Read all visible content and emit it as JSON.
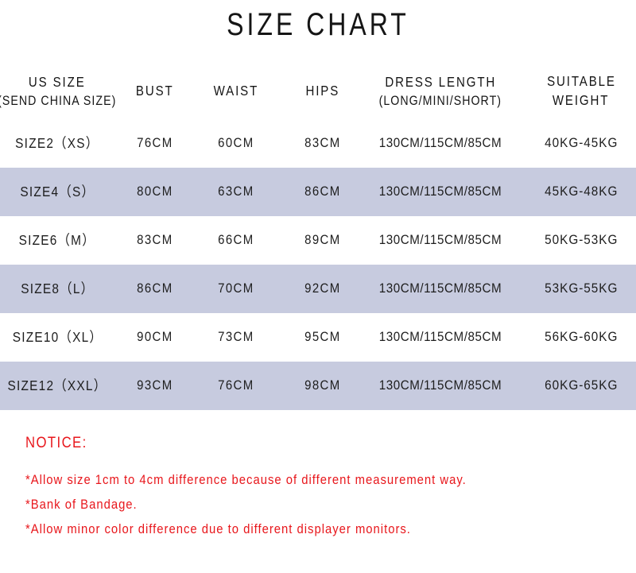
{
  "title": "SIZE CHART",
  "table": {
    "headers": [
      {
        "line1": "US SIZE",
        "line2": "(SEND CHINA SIZE)"
      },
      {
        "line1": "BUST",
        "line2": ""
      },
      {
        "line1": "WAIST",
        "line2": ""
      },
      {
        "line1": "HIPS",
        "line2": ""
      },
      {
        "line1": "DRESS LENGTH",
        "line2": "(LONG/MINI/SHORT)"
      },
      {
        "line1": "SUITABLE",
        "line2": "WEIGHT"
      }
    ],
    "rows": [
      {
        "size": "SIZE2（XS）",
        "bust": "76CM",
        "waist": "60CM",
        "hips": "83CM",
        "length": "130CM/115CM/85CM",
        "weight": "40KG-45KG",
        "shaded": false
      },
      {
        "size": "SIZE4（S）",
        "bust": "80CM",
        "waist": "63CM",
        "hips": "86CM",
        "length": "130CM/115CM/85CM",
        "weight": "45KG-48KG",
        "shaded": true
      },
      {
        "size": "SIZE6（M）",
        "bust": "83CM",
        "waist": "66CM",
        "hips": "89CM",
        "length": "130CM/115CM/85CM",
        "weight": "50KG-53KG",
        "shaded": false
      },
      {
        "size": "SIZE8（L）",
        "bust": "86CM",
        "waist": "70CM",
        "hips": "92CM",
        "length": "130CM/115CM/85CM",
        "weight": "53KG-55KG",
        "shaded": true
      },
      {
        "size": "SIZE10（XL）",
        "bust": "90CM",
        "waist": "73CM",
        "hips": "95CM",
        "length": "130CM/115CM/85CM",
        "weight": "56KG-60KG",
        "shaded": false
      },
      {
        "size": "SIZE12（XXL）",
        "bust": "93CM",
        "waist": "76CM",
        "hips": "98CM",
        "length": "130CM/115CM/85CM",
        "weight": "60KG-65KG",
        "shaded": true
      }
    ]
  },
  "notice": {
    "heading": "NOTICE:",
    "lines": [
      "*Allow size 1cm to 4cm difference because of different measurement way.",
      "*Bank of Bandage.",
      "*Allow minor color difference due to different displayer monitors."
    ]
  },
  "colors": {
    "band": "#c7cbdf",
    "text": "#1a1a1a",
    "notice": "#e8171c",
    "background": "#ffffff"
  }
}
